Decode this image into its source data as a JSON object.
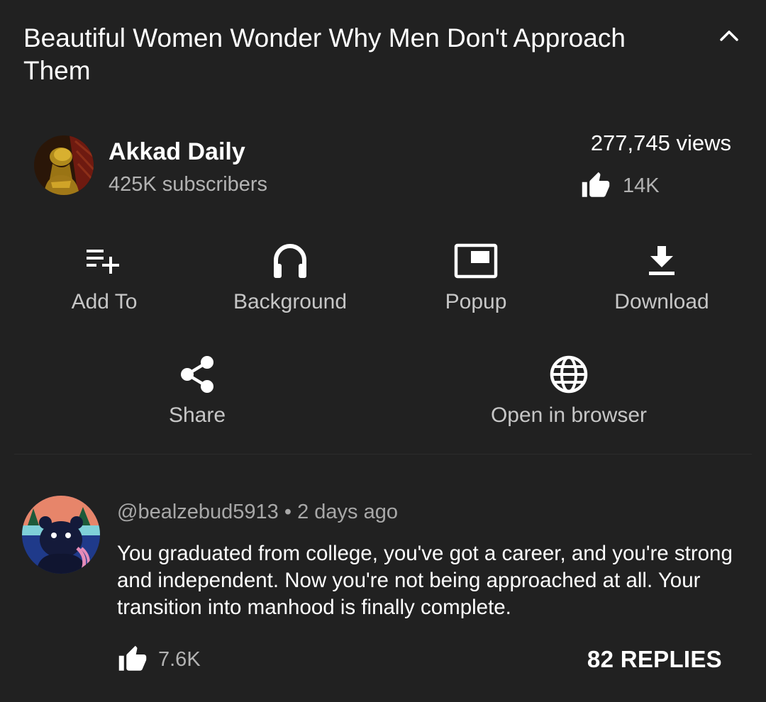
{
  "video": {
    "title": "Beautiful Women Wonder Why Men Don't Approach Them",
    "collapse_icon": "chevron-up-icon"
  },
  "channel": {
    "name": "Akkad Daily",
    "subscribers": "425K subscribers",
    "avatar_icon": "channel-avatar"
  },
  "stats": {
    "views": "277,745 views",
    "likes": "14K",
    "like_icon": "thumbs-up-icon"
  },
  "actions": [
    {
      "label": "Add To",
      "icon": "playlist-add-icon"
    },
    {
      "label": "Background",
      "icon": "headphones-icon"
    },
    {
      "label": "Popup",
      "icon": "picture-in-picture-icon"
    },
    {
      "label": "Download",
      "icon": "download-icon"
    },
    {
      "label": "Share",
      "icon": "share-icon"
    },
    {
      "label": "Open in browser",
      "icon": "globe-icon"
    }
  ],
  "comment": {
    "author": "@bealzebud5913",
    "separator": "•",
    "time": "2 days ago",
    "text": "You graduated from college, you've got a career, and you're strong and independent. Now you're not being approached at all. Your transition into manhood is finally complete.",
    "likes": "7.6K",
    "replies": "82 REPLIES"
  },
  "colors": {
    "background": "#212121",
    "text_primary": "#ffffff",
    "text_secondary": "#b3b3b3",
    "divider": "#2c2c2c"
  }
}
